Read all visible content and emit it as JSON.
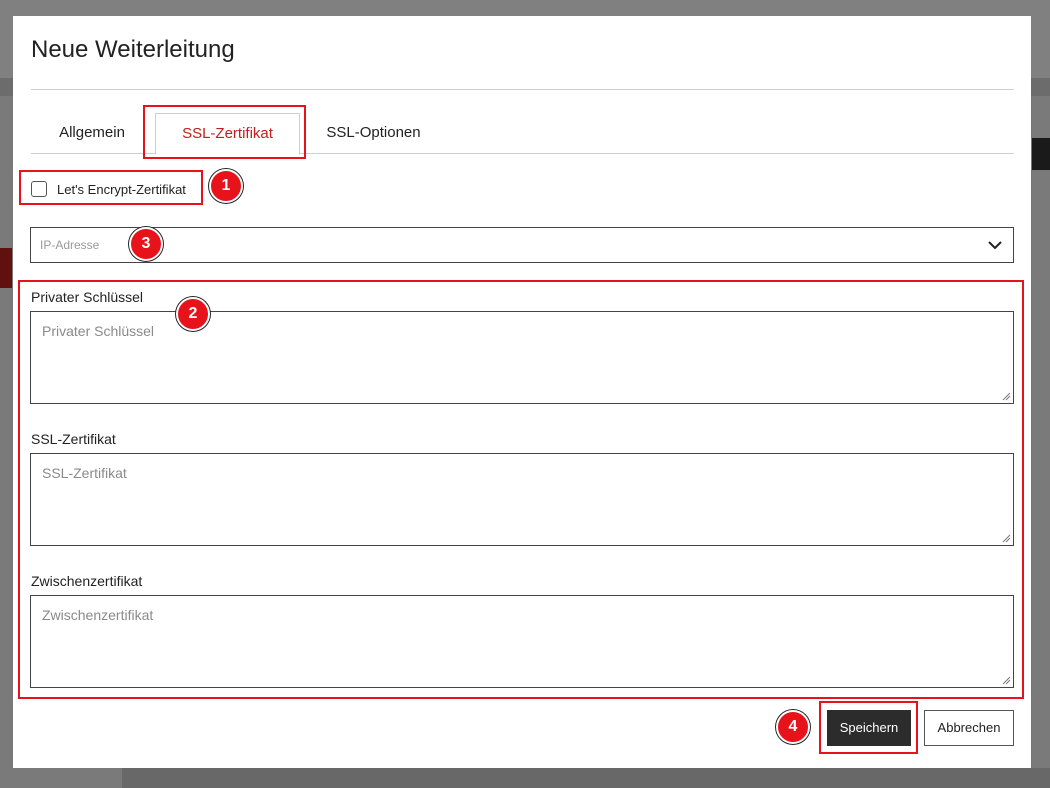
{
  "modal": {
    "title": "Neue Weiterleitung",
    "tabs": [
      {
        "label": "Allgemein",
        "active": false
      },
      {
        "label": "SSL-Zertifikat",
        "active": true
      },
      {
        "label": "SSL-Optionen",
        "active": false
      }
    ],
    "lets_encrypt": {
      "label": "Let's Encrypt-Zertifikat",
      "checked": false
    },
    "ip_select": {
      "placeholder": "IP-Adresse"
    },
    "fields": [
      {
        "label": "Privater Schlüssel",
        "placeholder": "Privater Schlüssel"
      },
      {
        "label": "SSL-Zertifikat",
        "placeholder": "SSL-Zertifikat"
      },
      {
        "label": "Zwischenzertifikat",
        "placeholder": "Zwischenzertifikat"
      }
    ],
    "buttons": {
      "save": "Speichern",
      "cancel": "Abbrechen"
    }
  },
  "annotations": [
    "1",
    "2",
    "3",
    "4"
  ],
  "colors": {
    "accent": "#c31d1d",
    "highlight": "#e8121a",
    "primary_button": "#2c2c2c"
  }
}
